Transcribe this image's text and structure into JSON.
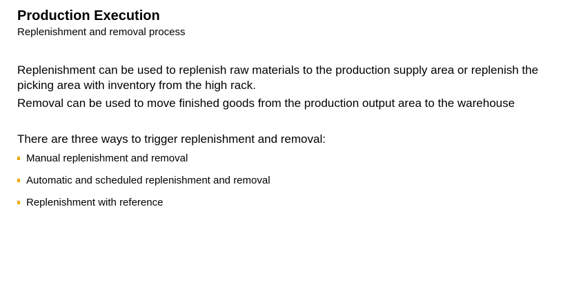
{
  "header": {
    "title": "Production Execution",
    "subtitle": "Replenishment and removal process"
  },
  "content": {
    "paragraph_1": "Replenishment can be used to replenish raw materials to the production supply area or replenish the picking area with inventory from the high rack.",
    "paragraph_2": "Removal can be used to move finished goods from the production output area to the warehouse",
    "paragraph_3": "There are three ways to trigger replenishment and removal:",
    "bullets": [
      "Manual replenishment and removal",
      "Automatic and scheduled replenishment and removal",
      "Replenishment with reference"
    ]
  },
  "colors": {
    "bullet": "#f0ab00",
    "text": "#000000",
    "background": "#ffffff"
  }
}
